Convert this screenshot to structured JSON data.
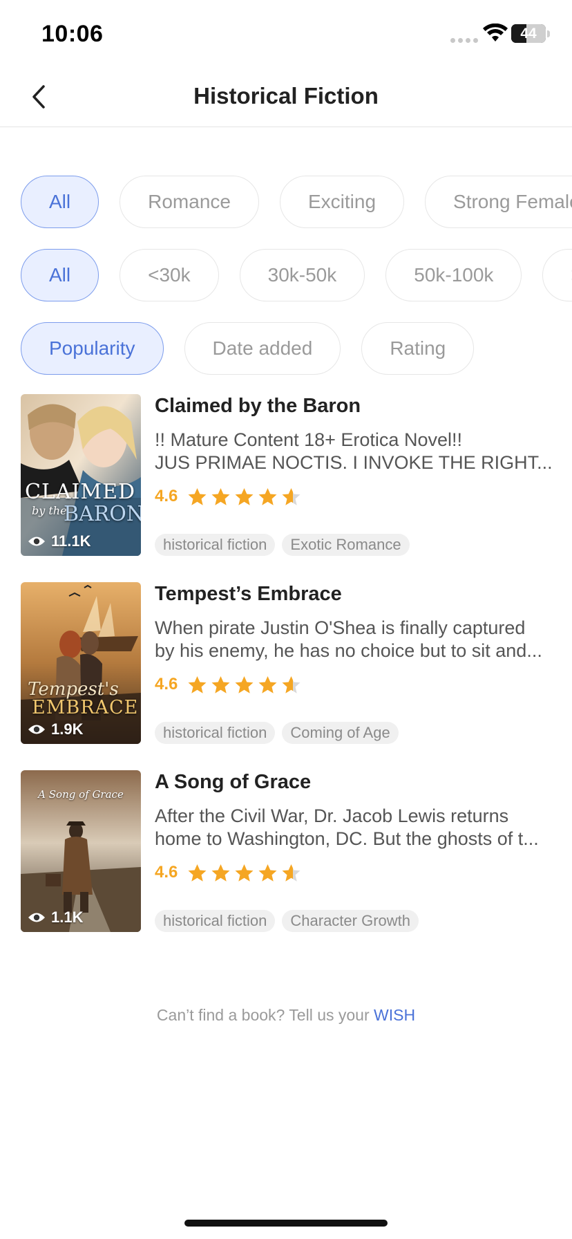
{
  "status_bar": {
    "time": "10:06",
    "battery": "44",
    "battery_level": 0.44
  },
  "nav": {
    "title": "Historical Fiction",
    "back_icon": "chevron-left-icon"
  },
  "filters": {
    "tags": [
      {
        "label": "All",
        "active": true
      },
      {
        "label": "Romance",
        "active": false
      },
      {
        "label": "Exciting",
        "active": false
      },
      {
        "label": "Strong Female L",
        "active": false
      }
    ],
    "word_counts": [
      {
        "label": "All",
        "active": true
      },
      {
        "label": "<30k",
        "active": false
      },
      {
        "label": "30k-50k",
        "active": false
      },
      {
        "label": "50k-100k",
        "active": false
      },
      {
        "label": ">",
        "active": false
      }
    ],
    "sort": [
      {
        "label": "Popularity",
        "active": true
      },
      {
        "label": "Date added",
        "active": false
      },
      {
        "label": "Rating",
        "active": false
      }
    ]
  },
  "books": [
    {
      "title": "Claimed by the Baron",
      "desc_line1": "!! Mature Content 18+ Erotica Novel!!",
      "desc_line2": "JUS PRIMAE NOCTIS. I INVOKE THE RIGHT...",
      "rating": "4.6",
      "rating_value": 4.6,
      "views": "11.1K",
      "tags": [
        "historical fiction",
        "Exotic Romance"
      ],
      "cover_text": [
        "CLAIMED",
        "by the",
        "BARON"
      ]
    },
    {
      "title": "Tempest’s Embrace",
      "desc_line1": "When pirate Justin O'Shea is finally captured",
      "desc_line2": "by his enemy, he has no choice but to sit and...",
      "rating": "4.6",
      "rating_value": 4.6,
      "views": "1.9K",
      "tags": [
        "historical fiction",
        "Coming of Age"
      ],
      "cover_text": [
        "Tempest's",
        "EMBRACE"
      ]
    },
    {
      "title": "A Song of Grace",
      "desc_line1": "After the Civil War, Dr. Jacob Lewis returns",
      "desc_line2": "home to Washington, DC. But the ghosts of t...",
      "rating": "4.6",
      "rating_value": 4.6,
      "views": "1.1K",
      "tags": [
        "historical fiction",
        "Character Growth"
      ],
      "cover_text": [
        "A Song of Grace"
      ]
    }
  ],
  "footer": {
    "prompt": "Can’t find a book?  Tell us your ",
    "link": "WISH"
  },
  "colors": {
    "accent": "#4a72d8",
    "active_chip_bg": "#e9efff",
    "star": "#f5a623"
  }
}
